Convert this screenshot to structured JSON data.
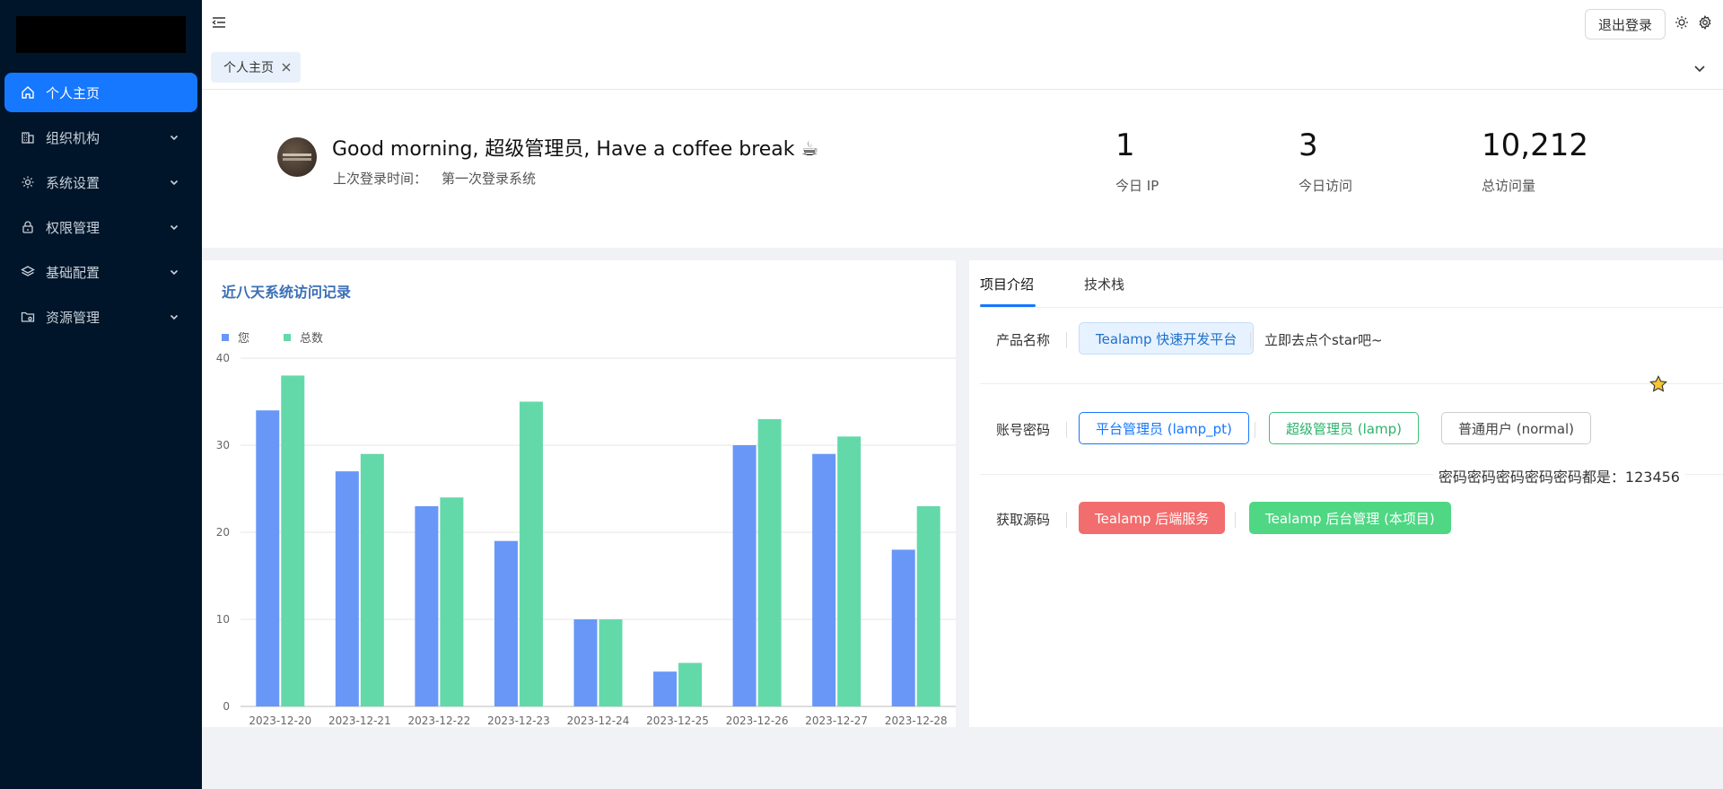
{
  "sidebar": {
    "items": [
      {
        "label": "个人主页",
        "icon": "home-icon",
        "active": true
      },
      {
        "label": "组织机构",
        "icon": "building-icon"
      },
      {
        "label": "系统设置",
        "icon": "gear-icon"
      },
      {
        "label": "权限管理",
        "icon": "lock-icon"
      },
      {
        "label": "基础配置",
        "icon": "layers-icon"
      },
      {
        "label": "资源管理",
        "icon": "folder-gear-icon"
      }
    ]
  },
  "header": {
    "logout_label": "退出登录"
  },
  "tabsbar": {
    "tabs": [
      {
        "label": "个人主页"
      }
    ]
  },
  "welcome": {
    "greeting": "Good morning, 超级管理员, Have a coffee break ☕",
    "last_login_label": "上次登录时间：",
    "last_login_value": "第一次登录系统",
    "stats": [
      {
        "value": "1",
        "label": "今日 IP"
      },
      {
        "value": "3",
        "label": "今日访问"
      },
      {
        "value": "10,212",
        "label": "总访问量"
      }
    ]
  },
  "chart_data": {
    "type": "bar",
    "title": "近八天系统访问记录",
    "categories": [
      "2023-12-20",
      "2023-12-21",
      "2023-12-22",
      "2023-12-23",
      "2023-12-24",
      "2023-12-25",
      "2023-12-26",
      "2023-12-27",
      "2023-12-28"
    ],
    "series": [
      {
        "name": "您",
        "values": [
          34,
          27,
          23,
          19,
          10,
          4,
          30,
          29,
          18
        ],
        "color": "#6897f7"
      },
      {
        "name": "总数",
        "values": [
          38,
          29,
          24,
          35,
          10,
          5,
          33,
          31,
          23
        ],
        "color": "#63d9a9"
      }
    ],
    "yticks": [
      0,
      10,
      20,
      30,
      40
    ],
    "ylim": [
      0,
      40
    ],
    "legend": "top-left",
    "grid": true
  },
  "info": {
    "tabs": [
      {
        "label": "项目介绍",
        "active": true
      },
      {
        "label": "技术栈"
      }
    ],
    "product_label": "产品名称",
    "product_name": "Tealamp 快速开发平台",
    "star_text": "立即去点个star吧~",
    "account_label": "账号密码",
    "accounts": [
      "平台管理员 (lamp_pt)",
      "超级管理员 (lamp)",
      "普通用户 (normal)"
    ],
    "password_note": "密码密码密码密码密码都是：123456",
    "source_label": "获取源码",
    "sources": [
      "Tealamp 后端服务",
      "Tealamp 后台管理 (本项目)"
    ]
  }
}
